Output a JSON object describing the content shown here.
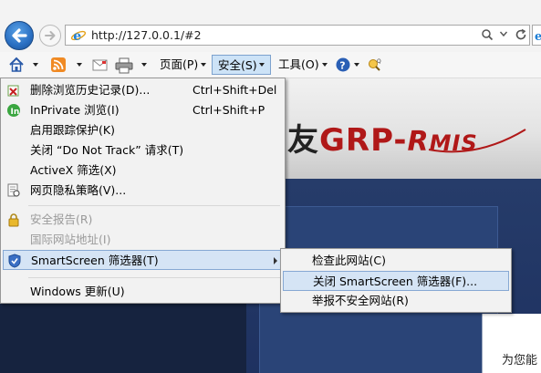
{
  "address_bar": {
    "url": "http://127.0.0.1/#2",
    "search_dropdown_glyph": "▾",
    "refresh_glyph": "C",
    "tools_glyphs": [
      "🔎",
      "▾",
      "C"
    ]
  },
  "command_bar": {
    "home_label": "",
    "page_label": "页面(P)",
    "safety_label": "安全(S)",
    "tools_label": "工具(O)"
  },
  "page": {
    "brand_cn": "友",
    "brand_en": "GRP-",
    "brand_rmis_r": "R",
    "brand_rmis_rest": "MIS",
    "side_text": "为您能"
  },
  "safety_menu": {
    "items": [
      {
        "label": "删除浏览历史记录(D)...",
        "shortcut": "Ctrl+Shift+Del",
        "icon": "delete-history-icon"
      },
      {
        "label": "InPrivate 浏览(I)",
        "shortcut": "Ctrl+Shift+P",
        "icon": "inprivate-icon"
      },
      {
        "label": "启用跟踪保护(K)",
        "shortcut": "",
        "icon": ""
      },
      {
        "label": "关闭 “Do Not Track” 请求(T)",
        "shortcut": "",
        "icon": ""
      },
      {
        "label": "ActiveX 筛选(X)",
        "shortcut": "",
        "icon": ""
      },
      {
        "label": "网页隐私策略(V)...",
        "shortcut": "",
        "icon": "privacy-report-icon"
      },
      {
        "label": "安全报告(R)",
        "shortcut": "",
        "icon": "lock-icon"
      },
      {
        "label": "国际网站地址(I)",
        "shortcut": "",
        "icon": ""
      },
      {
        "label": "SmartScreen 筛选器(T)",
        "shortcut": "",
        "icon": "smartscreen-icon"
      },
      {
        "label": "Windows 更新(U)",
        "shortcut": "",
        "icon": ""
      }
    ]
  },
  "smartscreen_submenu": {
    "items": [
      {
        "label": "检查此网站(C)"
      },
      {
        "label": "关闭 SmartScreen 筛选器(F)..."
      },
      {
        "label": "举报不安全网站(R)"
      }
    ]
  },
  "colors": {
    "menu_bg": "#f2f2f2",
    "highlight": "#d5e4f5",
    "brand_red": "#b01818"
  }
}
